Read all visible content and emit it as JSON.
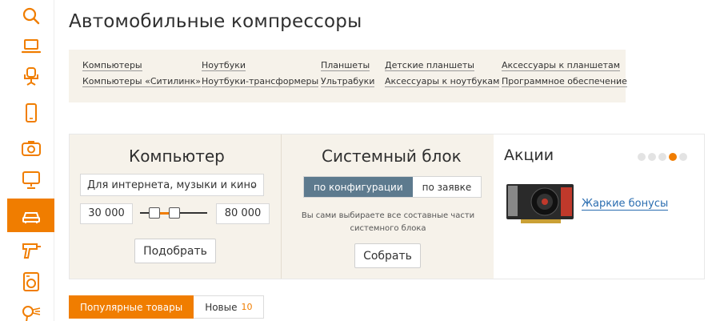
{
  "page": {
    "title": "Автомобильные компрессоры"
  },
  "colors": {
    "accent": "#f07d00",
    "panel_bg": "#f6f2ea",
    "segment_active": "#5d7a8e",
    "link": "#2a6db0"
  },
  "sidebar": {
    "items": [
      {
        "icon": "search-icon",
        "active": false
      },
      {
        "icon": "laptop-icon",
        "active": false
      },
      {
        "icon": "office-chair-icon",
        "active": false
      },
      {
        "icon": "smartphone-icon",
        "active": false
      },
      {
        "icon": "camera-icon",
        "active": false
      },
      {
        "icon": "monitor-icon",
        "active": false
      },
      {
        "icon": "car-icon",
        "active": true
      },
      {
        "icon": "drill-icon",
        "active": false
      },
      {
        "icon": "washing-machine-icon",
        "active": false
      },
      {
        "icon": "hair-dryer-icon",
        "active": false
      }
    ]
  },
  "categories": {
    "col1": [
      "Компьютеры",
      "Компьютеры «Ситилинк»"
    ],
    "col2": [
      "Ноутбуки",
      "Ноутбуки-трансформеры"
    ],
    "col3": [
      "Планшеты",
      "Ультрабуки"
    ],
    "col4": [
      "Детские планшеты",
      "Аксессуары к ноутбукам"
    ],
    "col5": [
      "Аксессуары к планшетам",
      "Программное обеспечение"
    ]
  },
  "computer_panel": {
    "title": "Компьютер",
    "select_value": "Для интернета, музыки и кино",
    "price_min": "30 000",
    "price_max": "80 000",
    "button": "Подобрать"
  },
  "system_panel": {
    "title": "Системный блок",
    "tab_active": "по конфигурации",
    "tab_inactive": "по заявке",
    "description": "Вы сами выбираете все составные части системного блока",
    "button": "Собрать"
  },
  "promo_panel": {
    "title": "Акции",
    "dots_total": 5,
    "dots_active_index": 3,
    "link": "Жаркие бонусы",
    "image_icon": "graphics-card-image"
  },
  "bottom_tabs": {
    "popular": "Популярные товары",
    "new": "Новые",
    "new_count": "10"
  }
}
